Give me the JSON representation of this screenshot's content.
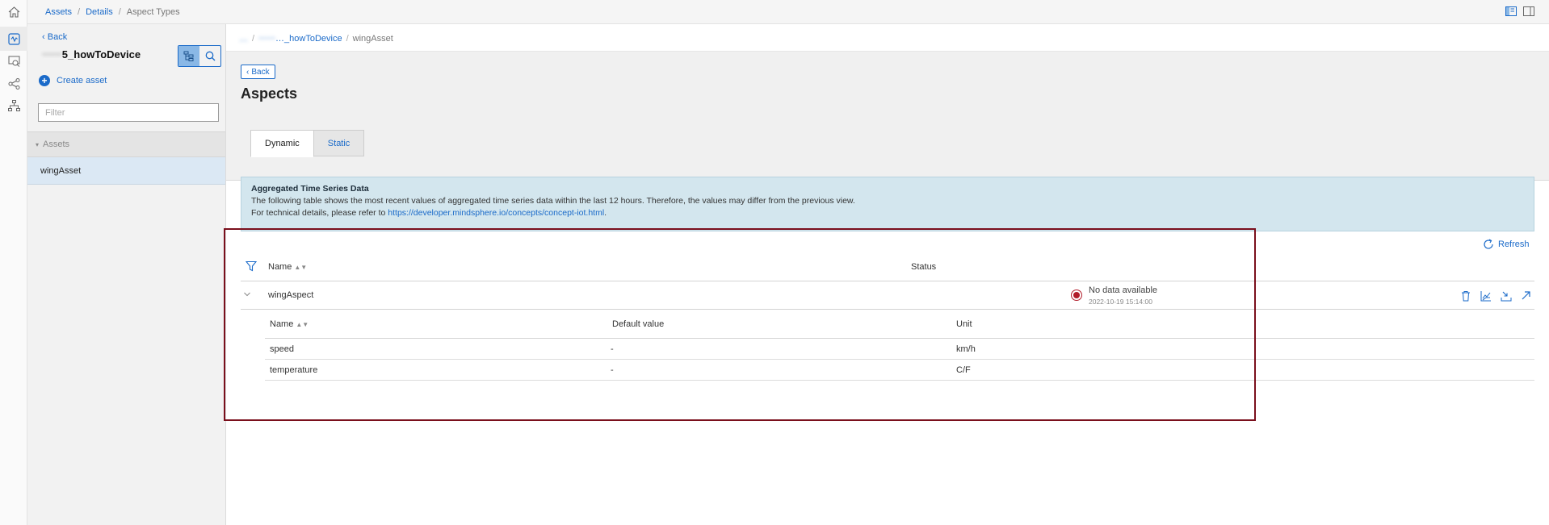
{
  "topbar": {
    "breadcrumbs": [
      "Assets",
      "Details",
      "Aspect Types"
    ]
  },
  "rail": {
    "icons": [
      "home-icon",
      "asset-manager-icon",
      "report-icon",
      "share-icon",
      "hierarchy-icon"
    ]
  },
  "sidebar": {
    "back_label": "Back",
    "asset_title": "5_howToDevice",
    "create_asset_label": "Create asset",
    "filter_placeholder": "Filter",
    "section_label": "Assets",
    "items": [
      {
        "label": "wingAsset"
      }
    ]
  },
  "main": {
    "breadcrumbs": [
      "…",
      "…_howToDevice",
      "wingAsset"
    ],
    "back_label": "Back",
    "title": "Aspects",
    "tabs": [
      {
        "label": "Dynamic",
        "active": true
      },
      {
        "label": "Static",
        "active": false
      }
    ],
    "info": {
      "title": "Aggregated Time Series Data",
      "line1": "The following table shows the most recent values of aggregated time series data within the last 12 hours. Therefore, the values may differ from the previous view.",
      "line2_prefix": "For technical details, please refer to ",
      "link": "https://developer.mindsphere.io/concepts/concept-iot.html",
      "line2_suffix": "."
    },
    "refresh_label": "Refresh",
    "table": {
      "columns": {
        "name": "Name",
        "status": "Status"
      },
      "aspect": {
        "name": "wingAspect",
        "status": "No data available",
        "status_time": "2022-10-19 15:14:00",
        "status_color": "#b11c2a"
      },
      "variables": {
        "columns": {
          "name": "Name",
          "default": "Default value",
          "unit": "Unit"
        },
        "rows": [
          {
            "name": "speed",
            "default": "-",
            "unit": "km/h"
          },
          {
            "name": "temperature",
            "default": "-",
            "unit": "C/F"
          }
        ]
      }
    }
  },
  "colors": {
    "accent": "#1a6ac9",
    "info_bg": "#d3e6ee",
    "highlight": "#7a0f1c"
  }
}
